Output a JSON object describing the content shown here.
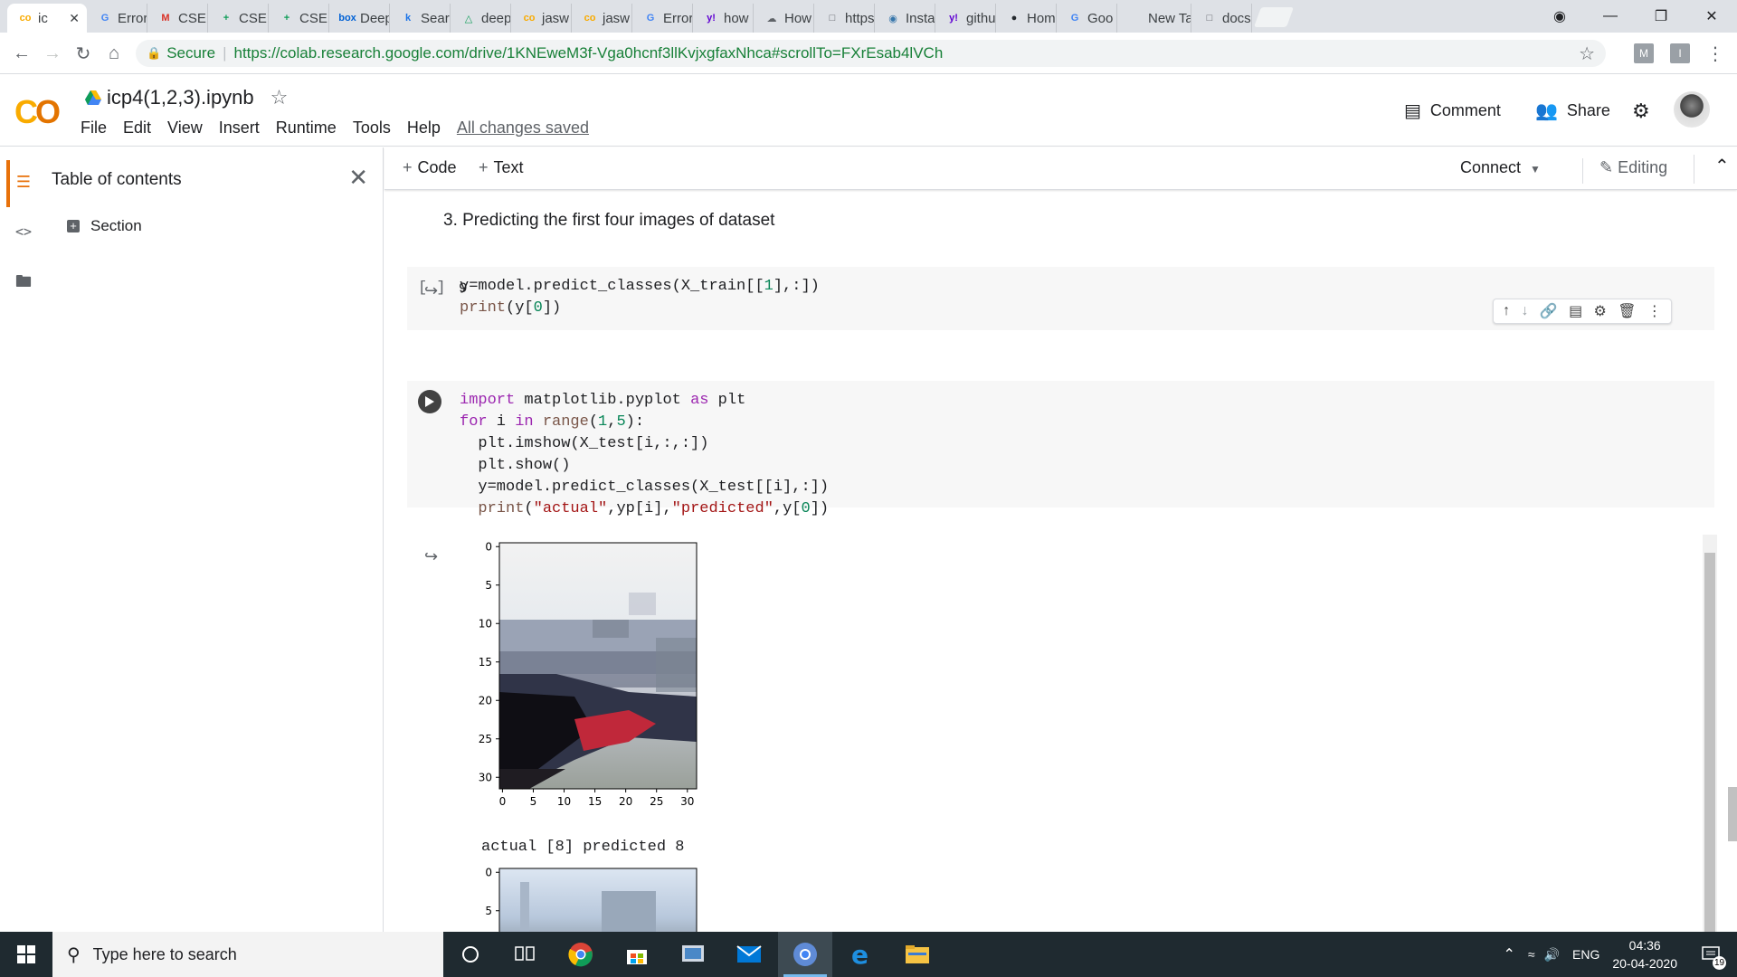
{
  "tabs": [
    {
      "label": "ic",
      "fav": "co",
      "color": "#f9ab00",
      "active": true
    },
    {
      "label": "Error",
      "fav": "G",
      "color": "#4285f4"
    },
    {
      "label": "CSEE",
      "fav": "M",
      "color": "#d93025"
    },
    {
      "label": "CSEE",
      "fav": "+",
      "color": "#0f9d58"
    },
    {
      "label": "CSEE",
      "fav": "+",
      "color": "#0f9d58"
    },
    {
      "label": "Deep",
      "fav": "box",
      "color": "#0061d5"
    },
    {
      "label": "Sear",
      "fav": "k",
      "color": "#1a73e8"
    },
    {
      "label": "deep",
      "fav": "△",
      "color": "#0f9d58"
    },
    {
      "label": "jasw",
      "fav": "co",
      "color": "#f9ab00"
    },
    {
      "label": "jasw",
      "fav": "co",
      "color": "#f9ab00"
    },
    {
      "label": "Error",
      "fav": "G",
      "color": "#4285f4"
    },
    {
      "label": "how",
      "fav": "y!",
      "color": "#6001d2"
    },
    {
      "label": "How",
      "fav": "☁",
      "color": "#5f6368"
    },
    {
      "label": "https",
      "fav": "□",
      "color": "#5f6368"
    },
    {
      "label": "Insta",
      "fav": "◉",
      "color": "#3776ab"
    },
    {
      "label": "githu",
      "fav": "y!",
      "color": "#6001d2"
    },
    {
      "label": "Hom",
      "fav": "●",
      "color": "#24292e"
    },
    {
      "label": "Goo",
      "fav": "G",
      "color": "#4285f4"
    },
    {
      "label": "New Tab",
      "fav": "",
      "color": "#5f6368"
    },
    {
      "label": "docs",
      "fav": "□",
      "color": "#5f6368"
    }
  ],
  "address": {
    "secure": "Secure",
    "url": "https://colab.research.google.com/drive/1KNEweM3f-Vga0hcnf3llKvjxgfaxNhca#scrollTo=FXrEsab4lVCh"
  },
  "extensions": [
    "M",
    "I"
  ],
  "notebook": {
    "title": "icp4(1,2,3).ipynb",
    "menu": [
      "File",
      "Edit",
      "View",
      "Insert",
      "Runtime",
      "Tools",
      "Help"
    ],
    "saved": "All changes saved",
    "comment": "Comment",
    "share": "Share"
  },
  "toc": {
    "title": "Table of contents",
    "section": "Section"
  },
  "toolbar": {
    "code": "Code",
    "text": "Text",
    "connect": "Connect",
    "editing": "Editing"
  },
  "cells": {
    "heading": "3. Predicting the first four images of dataset",
    "cell1_bracket": "[ ]",
    "cell1_output": "9",
    "actual_line": "actual [8] predicted 8"
  },
  "plot": {
    "yticks": [
      "0",
      "5",
      "10",
      "15",
      "20",
      "25",
      "30"
    ],
    "xticks": [
      "0",
      "5",
      "10",
      "15",
      "20",
      "25",
      "30"
    ],
    "yticks2": [
      "0",
      "5",
      "10"
    ]
  },
  "taskbar": {
    "search": "Type here to search",
    "lang": "ENG",
    "time": "04:36",
    "date": "20-04-2020",
    "notifications": "19"
  }
}
